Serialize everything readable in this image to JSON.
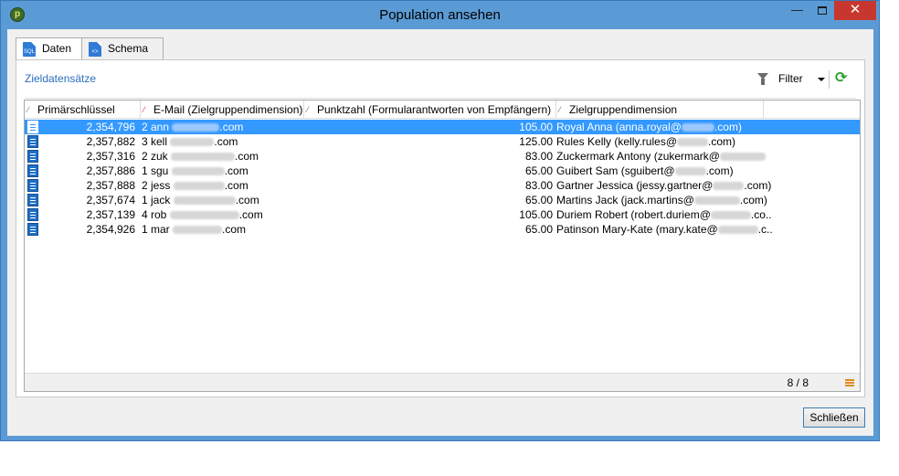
{
  "window": {
    "title": "Population ansehen",
    "close_symbol": "✕",
    "minimize_symbol": "—"
  },
  "tabs": [
    {
      "label": "Daten",
      "active": true
    },
    {
      "label": "Schema",
      "active": false
    }
  ],
  "panel": {
    "title": "Zieldatensätze",
    "filter_label": "Filter",
    "refresh_icon": "refresh-icon"
  },
  "grid": {
    "columns": [
      {
        "label": "Primärschlüssel",
        "sort": "⁄"
      },
      {
        "label": "E-Mail (Zielgruppendimension)",
        "sort": "⁄"
      },
      {
        "label": "Punktzahl (Formularantworten von Empfängern)",
        "sort": "⁄"
      },
      {
        "label": "Zielgruppendimension",
        "sort": "⁄"
      }
    ],
    "rows": [
      {
        "id": "2,354,796",
        "mail": "2 ann",
        "mail_end": ".com",
        "score": "105.00",
        "target": "Royal Anna (anna.royal@",
        "target_end": ".com)",
        "selected": true
      },
      {
        "id": "2,357,882",
        "mail": "3 kell",
        "mail_end": ".com",
        "score": "125.00",
        "target": "Rules Kelly (kelly.rules@",
        "target_end": ".com)",
        "selected": false
      },
      {
        "id": "2,357,316",
        "mail": "2 zuk",
        "mail_end": ".com",
        "score": "83.00",
        "target": "Zuckermark Antony (zukermark@",
        "target_end": "",
        "selected": false
      },
      {
        "id": "2,357,886",
        "mail": "1 sgu",
        "mail_end": ".com",
        "score": "65.00",
        "target": "Guibert Sam (sguibert@",
        "target_end": ".com)",
        "selected": false
      },
      {
        "id": "2,357,888",
        "mail": "2 jess",
        "mail_end": ".com",
        "score": "83.00",
        "target": "Gartner Jessica (jessy.gartner@",
        "target_end": ".com)",
        "selected": false
      },
      {
        "id": "2,357,674",
        "mail": "1 jack",
        "mail_end": ".com",
        "score": "65.00",
        "target": "Martins Jack (jack.martins@",
        "target_end": ".com)",
        "selected": false
      },
      {
        "id": "2,357,139",
        "mail": "4 rob",
        "mail_end": ".com",
        "score": "105.00",
        "target": "Duriem Robert (robert.duriem@",
        "target_end": ".co...",
        "selected": false
      },
      {
        "id": "2,354,926",
        "mail": "1 mar",
        "mail_end": ".com",
        "score": "65.00",
        "target": "Patinson Mary-Kate (mary.kate@",
        "target_end": ".c...",
        "selected": false
      }
    ],
    "count": "8 / 8"
  },
  "buttons": {
    "close": "Schließen"
  }
}
